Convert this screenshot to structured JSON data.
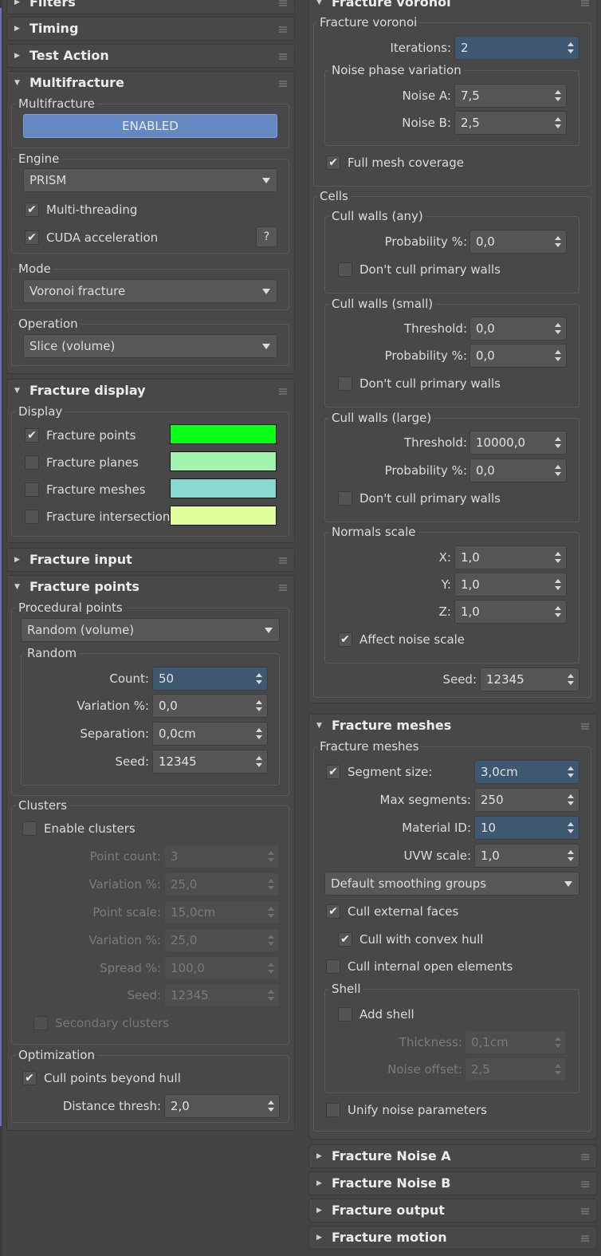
{
  "left": {
    "rollouts": {
      "filters": "Filters",
      "timing": "Timing",
      "test_action": "Test Action",
      "multifracture": "Multifracture",
      "fracture_display": "Fracture display",
      "fracture_input": "Fracture input",
      "fracture_points": "Fracture points"
    },
    "multifracture": {
      "group_label": "Multifracture",
      "enabled_button": "ENABLED",
      "engine_label": "Engine",
      "engine_value": "PRISM",
      "multithreading": "Multi-threading",
      "cuda": "CUDA acceleration",
      "help": "?",
      "mode_label": "Mode",
      "mode_value": "Voronoi fracture",
      "operation_label": "Operation",
      "operation_value": "Slice (volume)"
    },
    "display": {
      "group_label": "Display",
      "items": [
        {
          "label": "Fracture points",
          "checked": true,
          "color": "#0aff17"
        },
        {
          "label": "Fracture planes",
          "checked": false,
          "color": "#a4f4b0"
        },
        {
          "label": "Fracture meshes",
          "checked": false,
          "color": "#8ad9d0"
        },
        {
          "label": "Fracture intersections",
          "checked": false,
          "color": "#e2fe9c"
        }
      ]
    },
    "points": {
      "procedural_label": "Procedural points",
      "procedural_value": "Random (volume)",
      "random_label": "Random",
      "count_label": "Count:",
      "count_value": "50",
      "variation_label": "Variation %:",
      "variation_value": "0,0",
      "separation_label": "Separation:",
      "separation_value": "0,0cm",
      "seed_label": "Seed:",
      "seed_value": "12345",
      "clusters_label": "Clusters",
      "enable_clusters": "Enable clusters",
      "point_count_label": "Point count:",
      "point_count_value": "3",
      "c_variation_label": "Variation %:",
      "c_variation_value": "25,0",
      "point_scale_label": "Point scale:",
      "point_scale_value": "15,0cm",
      "c_variation2_label": "Variation %:",
      "c_variation2_value": "25,0",
      "spread_label": "Spread %:",
      "spread_value": "100,0",
      "c_seed_label": "Seed:",
      "c_seed_value": "12345",
      "secondary_clusters": "Secondary clusters",
      "optimization_label": "Optimization",
      "cull_hull": "Cull points beyond hull",
      "distance_label": "Distance thresh:",
      "distance_value": "2,0"
    }
  },
  "right": {
    "rollouts": {
      "fracture_voronoi": "Fracture voronoi",
      "fracture_meshes": "Fracture meshes",
      "noise_a": "Fracture Noise A",
      "noise_b": "Fracture Noise B",
      "output": "Fracture output",
      "motion": "Fracture motion"
    },
    "voronoi": {
      "group_label": "Fracture voronoi",
      "iterations_label": "Iterations:",
      "iterations_value": "2",
      "noise_phase_label": "Noise phase variation",
      "noise_a_label": "Noise A:",
      "noise_a_value": "7,5",
      "noise_b_label": "Noise B:",
      "noise_b_value": "2,5",
      "full_mesh": "Full mesh coverage",
      "cells_label": "Cells",
      "cull_any_label": "Cull walls (any)",
      "any_prob_label": "Probability %:",
      "any_prob_value": "0,0",
      "any_dont_cull": "Don't cull primary walls",
      "cull_small_label": "Cull walls (small)",
      "small_thresh_label": "Threshold:",
      "small_thresh_value": "0,0",
      "small_prob_label": "Probability %:",
      "small_prob_value": "0,0",
      "small_dont_cull": "Don't cull primary walls",
      "cull_large_label": "Cull walls (large)",
      "large_thresh_label": "Threshold:",
      "large_thresh_value": "10000,0",
      "large_prob_label": "Probability %:",
      "large_prob_value": "0,0",
      "large_dont_cull": "Don't cull primary walls",
      "normals_label": "Normals scale",
      "x_label": "X:",
      "x_value": "1,0",
      "y_label": "Y:",
      "y_value": "1,0",
      "z_label": "Z:",
      "z_value": "1,0",
      "affect_noise": "Affect noise scale",
      "seed_label": "Seed:",
      "seed_value": "12345"
    },
    "meshes": {
      "group_label": "Fracture meshes",
      "segment_size": "Segment size:",
      "segment_value": "3,0cm",
      "max_segments_label": "Max segments:",
      "max_segments_value": "250",
      "material_label": "Material ID:",
      "material_value": "10",
      "uvw_label": "UVW scale:",
      "uvw_value": "1,0",
      "smoothing_value": "Default smoothing groups",
      "cull_external": "Cull external faces",
      "cull_convex": "Cull with convex hull",
      "cull_internal": "Cull internal open elements",
      "shell_label": "Shell",
      "add_shell": "Add shell",
      "thickness_label": "Thickness:",
      "thickness_value": "0,1cm",
      "noise_offset_label": "Noise offset:",
      "noise_offset_value": "2,5",
      "unify_noise": "Unify noise parameters"
    }
  }
}
